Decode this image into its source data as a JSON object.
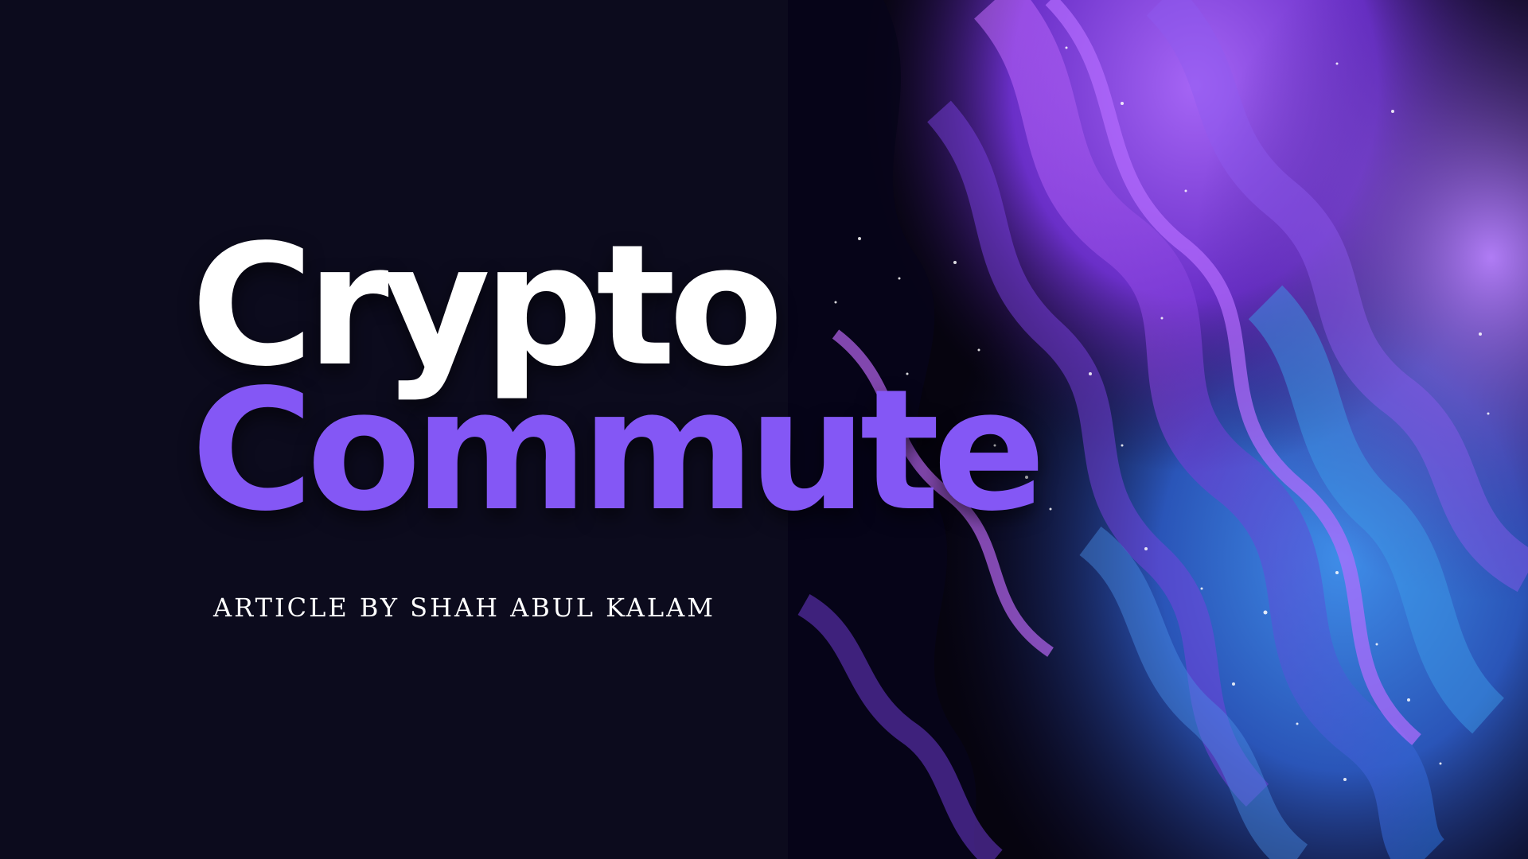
{
  "cover": {
    "title_line_1": "Crypto",
    "title_line_2": "Commute",
    "byline": "ARTICLE BY SHAH ABUL KALAM"
  },
  "colors": {
    "background": "#0c0b1d",
    "title_primary": "#ffffff",
    "title_accent": "#8457f5",
    "art_purple": "#8a3ff0",
    "art_blue": "#2f7de0"
  },
  "artwork": {
    "icon": "abstract-fluid-art-image"
  }
}
